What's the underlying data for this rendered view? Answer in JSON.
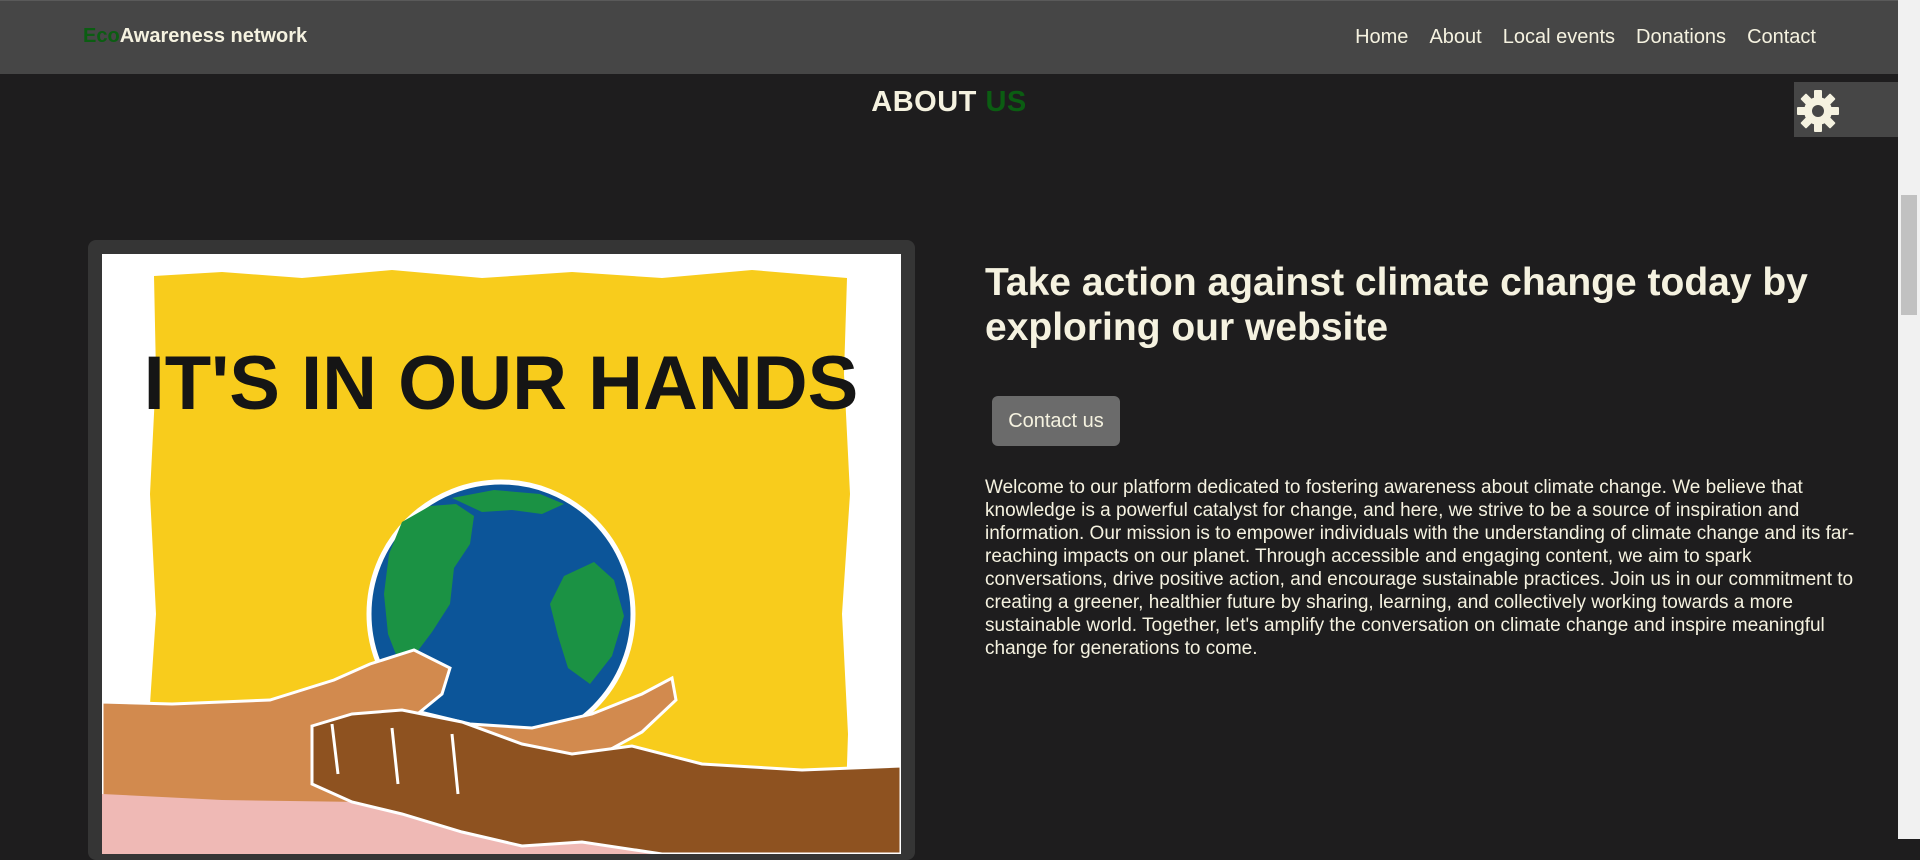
{
  "brand": {
    "accent": "Eco",
    "name": "Awareness network"
  },
  "nav": {
    "items": [
      {
        "label": "Home"
      },
      {
        "label": "About"
      },
      {
        "label": "Local events"
      },
      {
        "label": "Donations"
      },
      {
        "label": "Contact"
      }
    ]
  },
  "heading": {
    "main": "ABOUT ",
    "accent": "US"
  },
  "settings": {
    "icon": "gear-icon"
  },
  "poster": {
    "text": "IT'S IN OUR HANDS",
    "icon": "globe-in-hands-illustration"
  },
  "content": {
    "headline": "Take action against climate change today by exploring our website",
    "button_label": "Contact us",
    "body": "Welcome to our platform dedicated to fostering awareness about climate change. We believe that knowledge is a powerful catalyst for change, and here, we strive to be a source of inspiration and information. Our mission is to empower individuals with the understanding of climate change and its far-reaching impacts on our planet. Through accessible and engaging content, we aim to spark conversations, drive positive action, and encourage sustainable practices. Join us in our commitment to creating a greener, healthier future by sharing, learning, and collectively working towards a more sustainable world. Together, let's amplify the conversation on climate change and inspire meaningful change for generations to come."
  },
  "colors": {
    "background": "#1e1d1e",
    "navbar": "#464646",
    "text": "#f5f2e0",
    "accent_green": "#0b5d12",
    "button": "#6b6b6b",
    "poster_yellow": "#f8cc1c",
    "globe_blue": "#0c5599",
    "land_green": "#1b9244"
  }
}
